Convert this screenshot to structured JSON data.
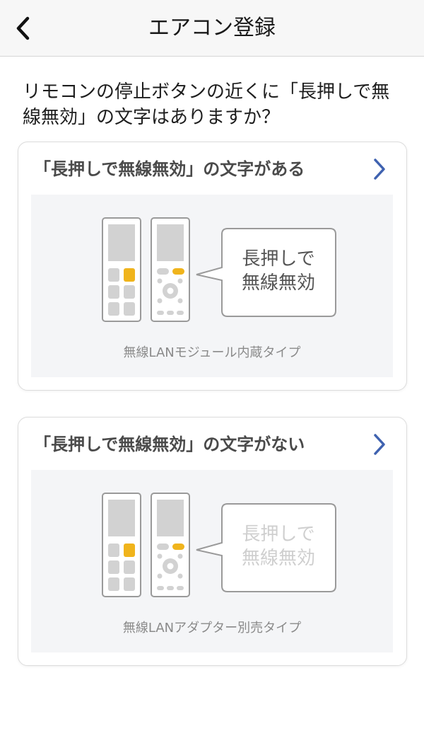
{
  "header": {
    "title": "エアコン登録",
    "back_icon": "chevron-left-icon"
  },
  "question": "リモコンの停止ボタンの近くに「長押しで無線無効」の文字はありますか？",
  "options": [
    {
      "title": "「長押しで無線無効」の文字がある",
      "bubble_line1": "長押しで",
      "bubble_line2": "無線無効",
      "caption": "無線LANモジュール内蔵タイプ",
      "chevron_icon": "chevron-right-icon"
    },
    {
      "title": "「長押しで無線無効」の文字がない",
      "bubble_line1": "長押しで",
      "bubble_line2": "無線無効",
      "caption": "無線LANアダプター別売タイプ",
      "chevron_icon": "chevron-right-icon"
    }
  ],
  "colors": {
    "accent_chevron": "#3f62b0",
    "highlight_button": "#f0b41c",
    "remote_gray": "#d2d2d2"
  }
}
